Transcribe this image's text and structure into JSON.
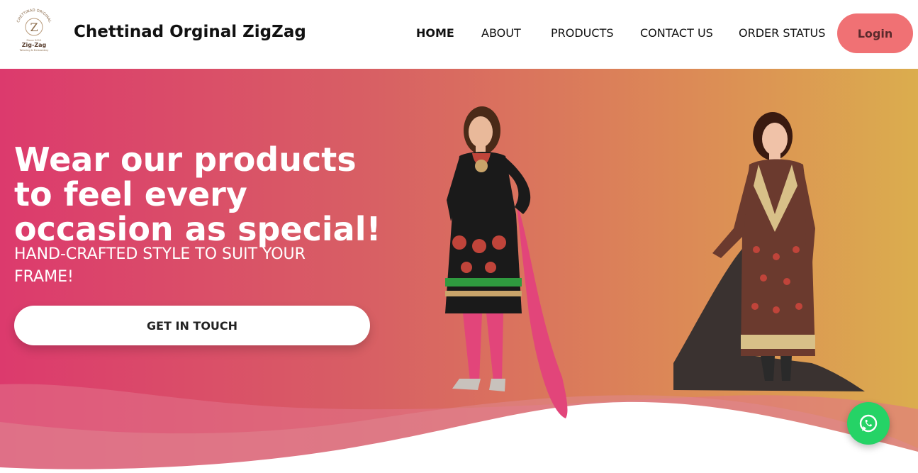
{
  "brand": {
    "logo_top_text": "CHETTINAD ORIGINAL",
    "logo_letter": "Z",
    "logo_since": "Since 2011",
    "logo_name": "Zig-Zag",
    "logo_tagline": "Tailoring & Embroidery",
    "title": "Chettinad Orginal ZigZag"
  },
  "nav": {
    "items": [
      "HOME",
      "ABOUT",
      "PRODUCTS",
      "CONTACT US",
      "ORDER STATUS"
    ],
    "active": "HOME",
    "login_label": "Login"
  },
  "hero": {
    "headline": "Wear our products to feel every occasion as special!",
    "subline": "HAND-CRAFTED STYLE TO SUIT YOUR FRAME!",
    "cta_label": "GET IN TOUCH"
  },
  "icons": {
    "whatsapp": "whatsapp-icon"
  },
  "colors": {
    "login_bg": "#f07174",
    "hero_gradient_start": "#dc3a6d",
    "hero_gradient_end": "#dbad4e",
    "whatsapp": "#25d366"
  }
}
